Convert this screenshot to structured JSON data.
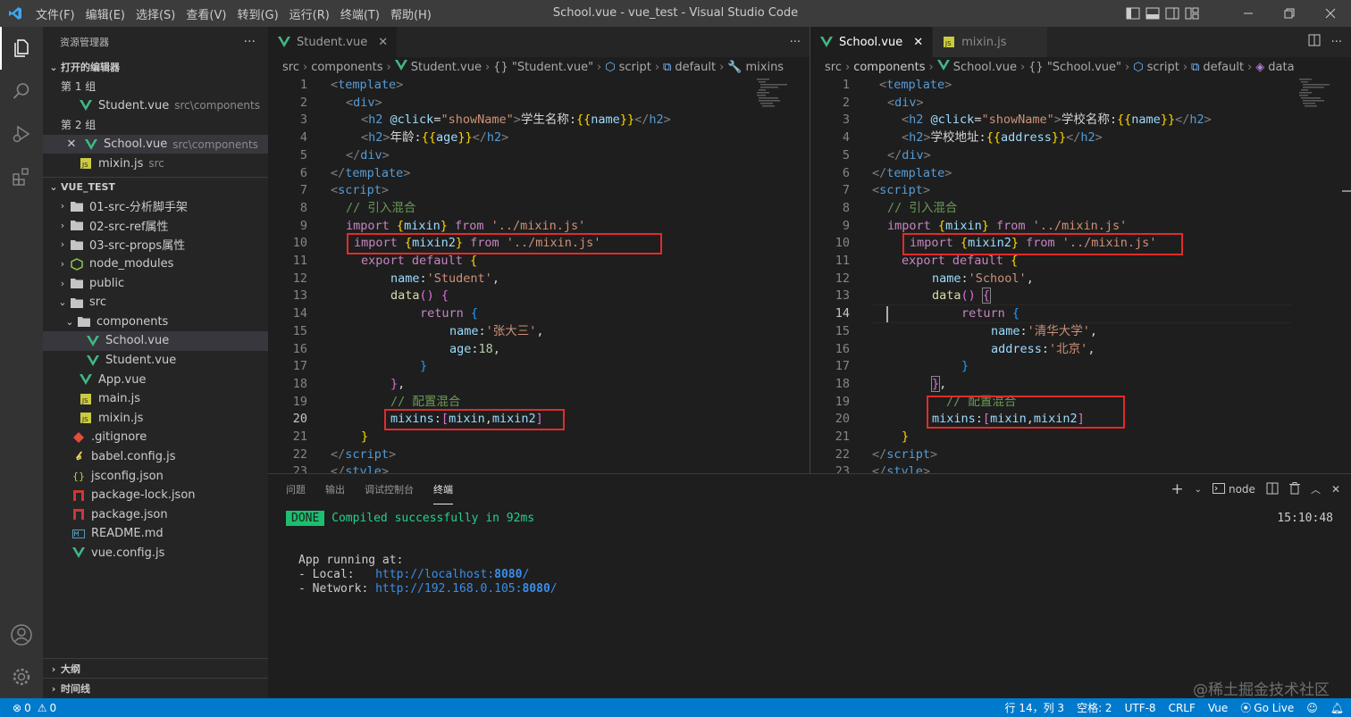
{
  "titlebar": {
    "menu": [
      "文件(F)",
      "编辑(E)",
      "选择(S)",
      "查看(V)",
      "转到(G)",
      "运行(R)",
      "终端(T)",
      "帮助(H)"
    ],
    "title": "School.vue - vue_test - Visual Studio Code"
  },
  "activity_bar": {
    "icons": [
      "explorer-icon",
      "search-icon",
      "run-debug-icon",
      "extensions-icon",
      "account-icon",
      "settings-gear-icon"
    ]
  },
  "sidebar": {
    "title": "资源管理器",
    "more": "···",
    "open_editors": {
      "title": "打开的编辑器",
      "groups": [
        {
          "label": "第 1 组",
          "files": [
            {
              "name": "Student.vue",
              "path": "src\\components"
            }
          ]
        },
        {
          "label": "第 2 组",
          "files": [
            {
              "name": "School.vue",
              "path": "src\\components"
            },
            {
              "name": "mixin.js",
              "path": "src"
            }
          ]
        }
      ]
    },
    "project": {
      "title": "VUE_TEST",
      "items": [
        {
          "name": "01-src-分析脚手架"
        },
        {
          "name": "02-src-ref属性"
        },
        {
          "name": "03-src-props属性"
        },
        {
          "name": "node_modules"
        },
        {
          "name": "public"
        },
        {
          "name": "src"
        },
        {
          "name": "components"
        },
        {
          "name": "School.vue"
        },
        {
          "name": "Student.vue"
        },
        {
          "name": "App.vue"
        },
        {
          "name": "main.js"
        },
        {
          "name": "mixin.js"
        },
        {
          "name": ".gitignore"
        },
        {
          "name": "babel.config.js"
        },
        {
          "name": "jsconfig.json"
        },
        {
          "name": "package-lock.json"
        },
        {
          "name": "package.json"
        },
        {
          "name": "README.md"
        },
        {
          "name": "vue.config.js"
        }
      ]
    },
    "outline": "大纲",
    "timeline": "时间线"
  },
  "editor_left": {
    "tabs": [
      "Student.vue"
    ],
    "breadcrumb": [
      "src",
      "components",
      "Student.vue",
      "{} \"Student.vue\"",
      "script",
      "default",
      "mixins"
    ],
    "line_numbers": [
      "1",
      "2",
      "3",
      "4",
      "5",
      "6",
      "7",
      "8",
      "9",
      "10",
      "11",
      "12",
      "13",
      "14",
      "15",
      "16",
      "17",
      "18",
      "19",
      "20",
      "21",
      "22",
      "23"
    ]
  },
  "editor_right": {
    "tabs": [
      "School.vue",
      "mixin.js"
    ],
    "breadcrumb": [
      "src",
      "components",
      "School.vue",
      "{} \"School.vue\"",
      "script",
      "default",
      "data"
    ],
    "line_numbers": [
      "1",
      "2",
      "3",
      "4",
      "5",
      "6",
      "7",
      "8",
      "9",
      "10",
      "11",
      "12",
      "13",
      "14",
      "15",
      "16",
      "17",
      "18",
      "19",
      "20",
      "21",
      "22",
      "23"
    ]
  },
  "panel": {
    "tabs": [
      "问题",
      "输出",
      "调试控制台",
      "终端"
    ],
    "terminal_name": "node",
    "done_badge": "DONE",
    "compiled": "Compiled successfully in 92ms",
    "time": "15:10:48",
    "running_at": "App running at:",
    "local_label": "- Local:   ",
    "local_url_prefix": "http://localhost:",
    "port": "8080",
    "url_suffix": "/",
    "network_label": "- Network: ",
    "network_url_prefix": "http://192.168.0.105:"
  },
  "statusbar": {
    "errors": "0",
    "warnings": "0",
    "position": "行 14，列 3",
    "spaces": "空格: 2",
    "encoding": "UTF-8",
    "eol": "CRLF",
    "language": "Vue",
    "golive": "Go Live"
  },
  "watermark": "@稀土掘金技术社区"
}
